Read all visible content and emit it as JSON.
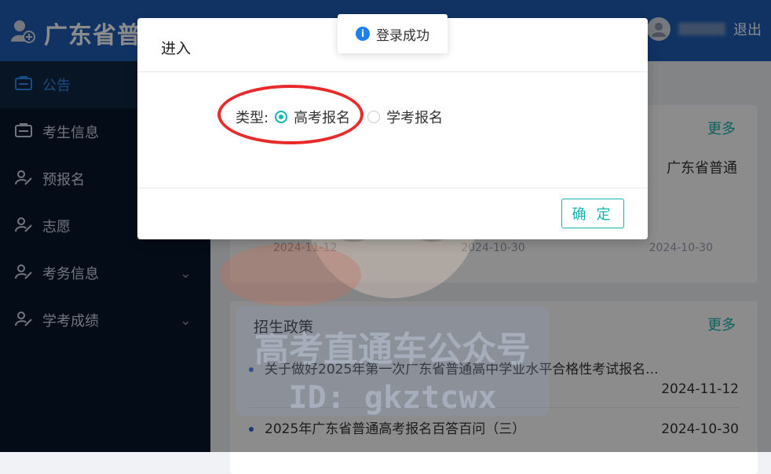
{
  "header": {
    "title": "广东省普",
    "logout": "退出"
  },
  "sidebar": {
    "items": [
      {
        "label": "公告",
        "icon": "id-card-icon",
        "active": true,
        "expandable": false
      },
      {
        "label": "考生信息",
        "icon": "id-card-icon",
        "active": false,
        "expandable": false
      },
      {
        "label": "预报名",
        "icon": "user-edit-icon",
        "active": false,
        "expandable": false
      },
      {
        "label": "志愿",
        "icon": "user-edit-icon",
        "active": false,
        "expandable": false
      },
      {
        "label": "考务信息",
        "icon": "user-edit-icon",
        "active": false,
        "expandable": true
      },
      {
        "label": "学考成绩",
        "icon": "user-edit-icon",
        "active": false,
        "expandable": true
      }
    ]
  },
  "main": {
    "card1": {
      "more": "更多",
      "preview_text": "广东省普通",
      "dates": [
        "2024-11-12",
        "2024-10-30",
        "2024-10-30"
      ]
    },
    "card2": {
      "title": "招生政策",
      "more": "更多",
      "items": [
        {
          "text": "关于做好2025年第一次广东省普通高中学业水平合格性考试报名...",
          "date": "2024-11-12"
        },
        {
          "text": "2025年广东省普通高考报名百答百问（三）",
          "date": "2024-10-30"
        }
      ]
    }
  },
  "dialog": {
    "title": "进入",
    "type_label": "类型:",
    "options": [
      {
        "label": "高考报名",
        "selected": true
      },
      {
        "label": "学考报名",
        "selected": false
      }
    ],
    "ok_label": "确 定"
  },
  "toast": {
    "message": "登录成功"
  },
  "watermark": {
    "line1": "高考直通车公众号",
    "line2": "ID: gkztcwx"
  },
  "colors": {
    "header_bg": "#1e5eb6",
    "sidebar_bg": "#08162a",
    "accent": "#13b5b1",
    "annotation": "#e82a2a"
  }
}
